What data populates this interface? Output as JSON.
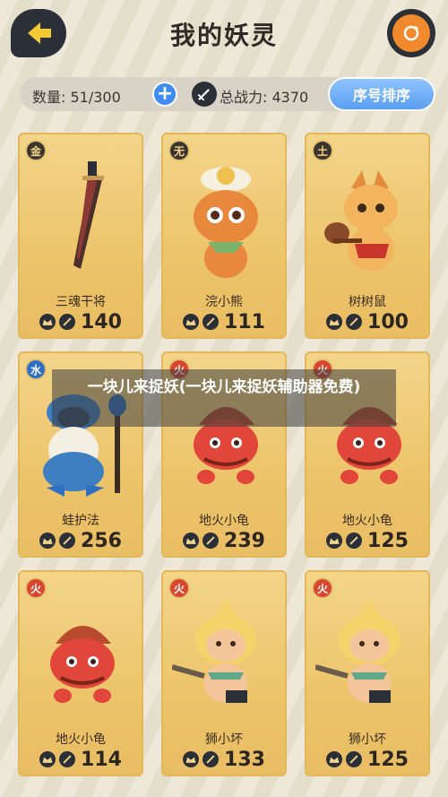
{
  "header": {
    "title": "我的妖灵",
    "icons": {
      "back": "back-arrow-icon",
      "settings": "orange-cycle-icon"
    }
  },
  "info_bar": {
    "count_label": "数量: 51/300",
    "add_symbol": "+",
    "power_label": "总战力: 4370",
    "sort_label": "序号排序"
  },
  "cards": [
    {
      "element": "金",
      "element_type": "metal",
      "name": "三魂干将",
      "power": "140",
      "art": "sword"
    },
    {
      "element": "无",
      "element_type": "none",
      "name": "浣小熊",
      "power": "111",
      "art": "raccoon"
    },
    {
      "element": "土",
      "element_type": "earth",
      "name": "树树鼠",
      "power": "100",
      "art": "squirrel"
    },
    {
      "element": "水",
      "element_type": "water",
      "name": "蛙护法",
      "power": "256",
      "art": "frog"
    },
    {
      "element": "火",
      "element_type": "fire",
      "name": "地火小龟",
      "power": "239",
      "art": "turtle"
    },
    {
      "element": "火",
      "element_type": "fire",
      "name": "地火小龟",
      "power": "125",
      "art": "turtle"
    },
    {
      "element": "火",
      "element_type": "fire",
      "name": "地火小龟",
      "power": "114",
      "art": "turtle"
    },
    {
      "element": "火",
      "element_type": "fire",
      "name": "狮小坏",
      "power": "133",
      "art": "lion"
    },
    {
      "element": "火",
      "element_type": "fire",
      "name": "狮小坏",
      "power": "125",
      "art": "lion"
    }
  ],
  "caption": "一块儿来捉妖(一块儿来捉妖辅助器免费)",
  "colors": {
    "card": "#f3d58a",
    "accent_blue": "#3f8df0",
    "fire": "#d9452f",
    "water": "#2e6fc4"
  }
}
